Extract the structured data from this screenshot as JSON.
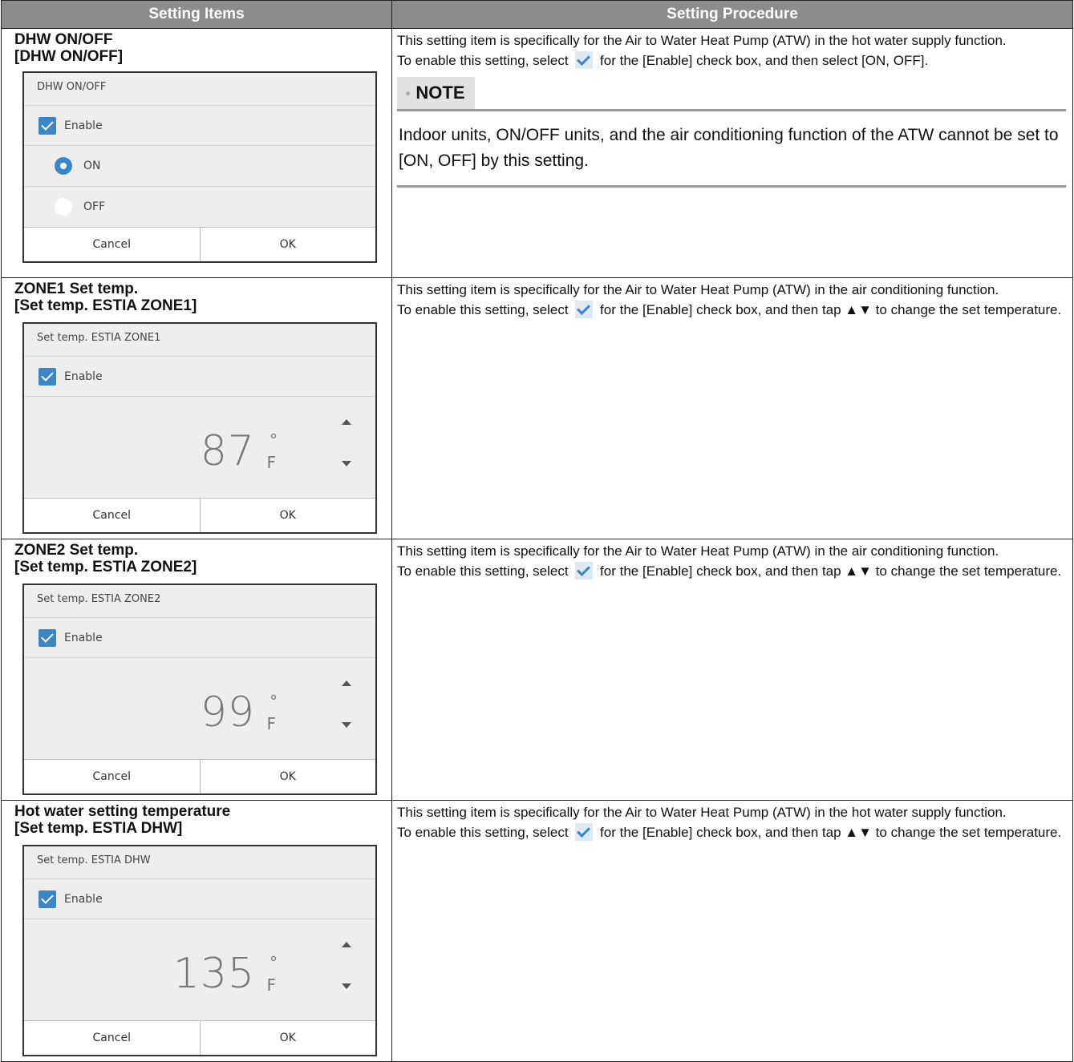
{
  "header": {
    "col1": "Setting Items",
    "col2": "Setting Procedure"
  },
  "rows": [
    {
      "title1": "DHW ON/OFF",
      "title2": "[DHW ON/OFF]",
      "dialog": {
        "title": "DHW ON/OFF",
        "enable": "Enable",
        "options": [
          "ON",
          "OFF"
        ],
        "selected": "ON",
        "cancel": "Cancel",
        "ok": "OK"
      },
      "proc1": "This setting item is specifically for the Air to Water Heat Pump (ATW) in the hot water supply function.",
      "proc2a": "To enable this setting, select",
      "proc2b": "for the [Enable] check box, and then select [ON, OFF].",
      "note_label": "NOTE",
      "note_text": "Indoor units, ON/OFF units, and the air conditioning function of the ATW cannot be set to [ON, OFF] by this setting."
    },
    {
      "title1": "ZONE1 Set temp.",
      "title2": "[Set temp. ESTIA ZONE1]",
      "dialog": {
        "title": "Set temp. ESTIA ZONE1",
        "enable": "Enable",
        "value": "87",
        "deg": "°",
        "unit": "F",
        "cancel": "Cancel",
        "ok": "OK"
      },
      "proc1": "This setting item is specifically for the Air to Water Heat Pump (ATW) in the air conditioning function.",
      "proc2a": "To enable this setting, select",
      "proc2b": "for the [Enable] check box, and then tap ▲▼ to change the set temperature."
    },
    {
      "title1": "ZONE2 Set temp.",
      "title2": "[Set temp. ESTIA ZONE2]",
      "dialog": {
        "title": "Set temp. ESTIA ZONE2",
        "enable": "Enable",
        "value": "99",
        "deg": "°",
        "unit": "F",
        "cancel": "Cancel",
        "ok": "OK"
      },
      "proc1": "This setting item is specifically for the Air to Water Heat Pump (ATW) in the air conditioning function.",
      "proc2a": "To enable this setting, select",
      "proc2b": "for the [Enable] check box, and then tap ▲▼ to change the set temperature."
    },
    {
      "title1": "Hot water setting temperature",
      "title2": "[Set temp. ESTIA DHW]",
      "dialog": {
        "title": "Set temp. ESTIA DHW",
        "enable": "Enable",
        "value": "135",
        "deg": "°",
        "unit": "F",
        "cancel": "Cancel",
        "ok": "OK"
      },
      "proc1": "This setting item is specifically for the Air to Water Heat Pump (ATW) in the hot water supply function.",
      "proc2a": "To enable this setting, select",
      "proc2b": "for the [Enable] check box, and then tap ▲▼ to change the set temperature."
    }
  ]
}
